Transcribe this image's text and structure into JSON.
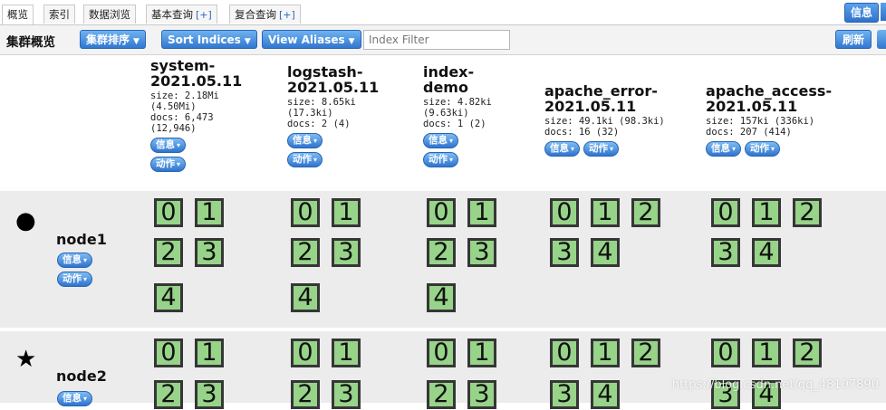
{
  "tabs": [
    {
      "label": "概览",
      "plus": ""
    },
    {
      "label": "索引",
      "plus": ""
    },
    {
      "label": "数据浏览",
      "plus": ""
    },
    {
      "label": "基本查询",
      "plus": "[+]"
    },
    {
      "label": "复合查询",
      "plus": "[+]"
    }
  ],
  "top_info_label": "信息",
  "toolbar": {
    "title": "集群概览",
    "cluster_sort": "集群排序",
    "sort_indices": "Sort Indices",
    "view_aliases": "View Aliases",
    "filter_placeholder": "Index Filter",
    "refresh": "刷新"
  },
  "pill_labels": {
    "info": "信息",
    "action": "动作",
    "caret": "▾"
  },
  "indices": [
    {
      "name": "system-\n2021.05.11",
      "meta": "size: 2.18Mi\n(4.50Mi)\ndocs: 6,473\n(12,946)"
    },
    {
      "name": "logstash-\n2021.05.11",
      "meta": "size: 8.65ki\n(17.3ki)\ndocs: 2 (4)"
    },
    {
      "name": "index-\ndemo",
      "meta": "size: 4.82ki\n(9.63ki)\ndocs: 1 (2)"
    },
    {
      "name": "apache_error-\n2021.05.11",
      "meta": "size: 49.1ki (98.3ki)\ndocs: 16 (32)"
    },
    {
      "name": "apache_access-\n2021.05.11",
      "meta": "size: 157ki (336ki)\ndocs: 207 (414)"
    }
  ],
  "nodes": [
    {
      "name": "node1",
      "mark": "●"
    },
    {
      "name": "node2",
      "mark": "★"
    }
  ],
  "shards": {
    "node1": [
      [
        "0",
        "1",
        "2",
        "3",
        "4"
      ],
      [
        "0",
        "1",
        "2",
        "3",
        "4"
      ],
      [
        "0",
        "1",
        "2",
        "3",
        "4"
      ],
      [
        "0",
        "1",
        "2",
        "3",
        "4"
      ],
      [
        "0",
        "1",
        "2",
        "3",
        "4"
      ]
    ],
    "node2": [
      [
        "0",
        "1",
        "2",
        "3"
      ],
      [
        "0",
        "1",
        "2",
        "3"
      ],
      [
        "0",
        "1",
        "2",
        "3"
      ],
      [
        "0",
        "1",
        "2",
        "3",
        "4"
      ],
      [
        "0",
        "1",
        "2",
        "3",
        "4"
      ]
    ]
  },
  "watermark": "https://blog.csdn.net/qq_48107890"
}
